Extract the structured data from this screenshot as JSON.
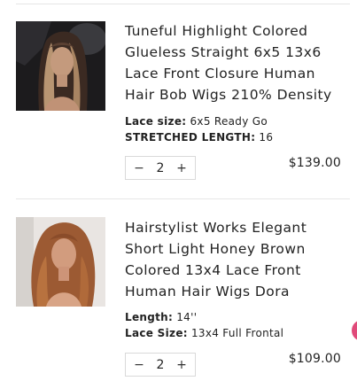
{
  "cart": {
    "items": [
      {
        "title": "Tuneful Highlight Colored Glueless Straight 6x5 13x6 Lace Front Closure Human Hair Bob Wigs 210% Density",
        "props": [
          {
            "key": "Lace size:",
            "value": "6x5 Ready Go"
          },
          {
            "key": "STRETCHED LENGTH:",
            "value": "16"
          }
        ],
        "quantity": "2",
        "price": "$139.00",
        "minus": "−",
        "plus": "+"
      },
      {
        "title": "Hairstylist Works Elegant Short Light Honey Brown Colored 13x4 Lace Front Human Hair Wigs Dora",
        "props": [
          {
            "key": "Length:",
            "value": "14''"
          },
          {
            "key": "Lace Size:",
            "value": "13x4 Full Frontal"
          }
        ],
        "quantity": "2",
        "price": "$109.00",
        "minus": "−",
        "plus": "+"
      }
    ]
  },
  "colors": {
    "divider": "#e6e6e6",
    "chat_button": "#e04a7a"
  }
}
